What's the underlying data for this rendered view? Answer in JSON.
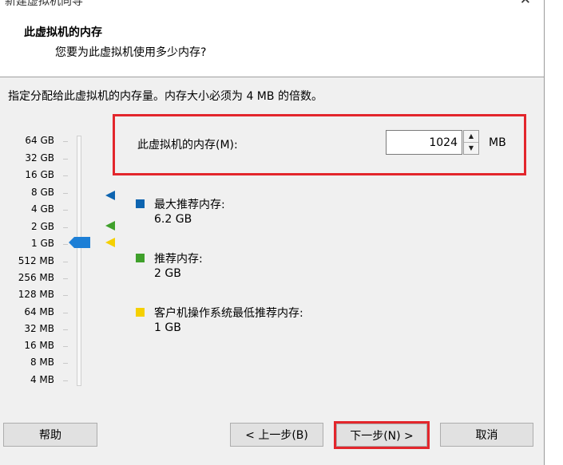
{
  "window": {
    "title": "新建虚拟机向导",
    "close_symbol": "✕"
  },
  "header": {
    "title": "此虚拟机的内存",
    "subtitle": "您要为此虚拟机使用多少内存?"
  },
  "instruction": "指定分配给此虚拟机的内存量。内存大小必须为 4 MB 的倍数。",
  "scale_labels": [
    "64 GB",
    "32 GB",
    "16 GB",
    "8 GB",
    "4 GB",
    "2 GB",
    "1 GB",
    "512 MB",
    "256 MB",
    "128 MB",
    "64 MB",
    "32 MB",
    "16 MB",
    "8 MB",
    "4 MB"
  ],
  "slider": {
    "selected": "1 GB"
  },
  "memory": {
    "label": "此虚拟机的内存(M):",
    "value": "1024",
    "unit": "MB"
  },
  "legend": {
    "max": {
      "label": "最大推荐内存:",
      "value": "6.2 GB",
      "color": "#0d64b0"
    },
    "recommended": {
      "label": "推荐内存:",
      "value": "2 GB",
      "color": "#3fa02b"
    },
    "minimum": {
      "label": "客户机操作系统最低推荐内存:",
      "value": "1 GB",
      "color": "#f5d000"
    }
  },
  "slider_colors": {
    "thumb": "#1d7fd6"
  },
  "highlight_color": "#e3262c",
  "buttons": {
    "help": "帮助",
    "back": "< 上一步(B)",
    "next": "下一步(N) >",
    "cancel": "取消"
  }
}
